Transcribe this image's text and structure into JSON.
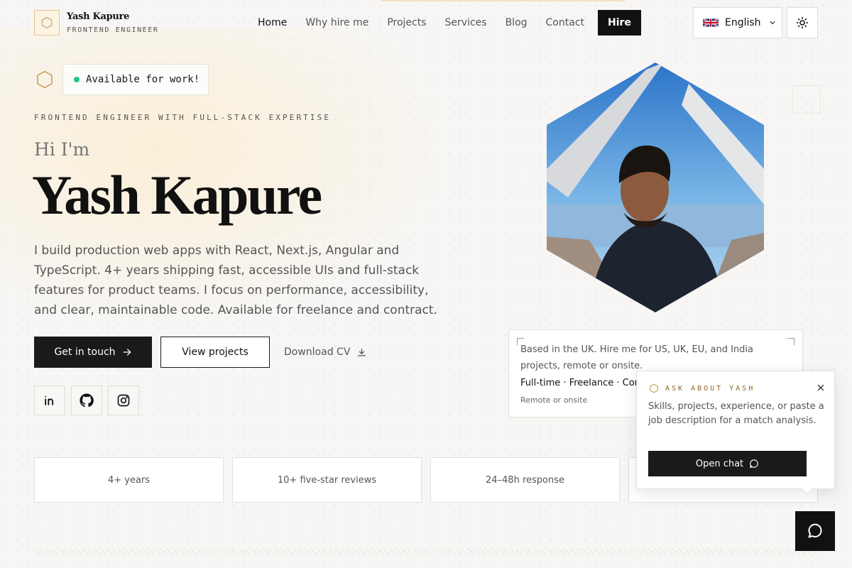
{
  "brand": {
    "name": "Yash Kapure",
    "role": "FRONTEND ENGINEER",
    "logo_icon": "hexagon-icon"
  },
  "nav": {
    "items": [
      {
        "label": "Home",
        "active": true
      },
      {
        "label": "Why hire me"
      },
      {
        "label": "Projects"
      },
      {
        "label": "Services"
      },
      {
        "label": "Blog"
      },
      {
        "label": "Contact"
      }
    ],
    "hire_label": "Hire"
  },
  "language": {
    "selected": "English",
    "flag_icon": "uk-flag-icon"
  },
  "theme_toggle_icon": "sun-icon",
  "hero": {
    "status": "Available for work!",
    "eyebrow": "FRONTEND ENGINEER WITH FULL-STACK EXPERTISE",
    "greeting": "Hi I'm",
    "name": "Yash Kapure",
    "description": "I build production web apps with React, Next.js, Angular and TypeScript. 4+ years shipping fast, accessible UIs and full-stack features for product teams. I focus on performance, accessibility, and clear, maintainable code. Available for freelance and contract.",
    "primary_cta": "Get in touch",
    "secondary_cta": "View projects",
    "download_cta": "Download CV",
    "socials": [
      {
        "icon": "linkedin-icon"
      },
      {
        "icon": "github-icon"
      },
      {
        "icon": "instagram-icon"
      }
    ]
  },
  "location_card": {
    "text": "Based in the UK. Hire me for US, UK, EU, and India projects, remote or onsite.",
    "engagement": "Full-time · Freelance · Con",
    "note": "Remote or onsite"
  },
  "stats": [
    "4+ years",
    "10+ five-star reviews",
    "24–48h response"
  ],
  "chat": {
    "title": "ASK ABOUT YASH",
    "description": "Skills, projects, experience, or paste a job description for a match analysis.",
    "open_label": "Open chat"
  },
  "colors": {
    "accent_gold": "#c9a35a",
    "status_green": "#22c47c",
    "ink": "#111111"
  }
}
